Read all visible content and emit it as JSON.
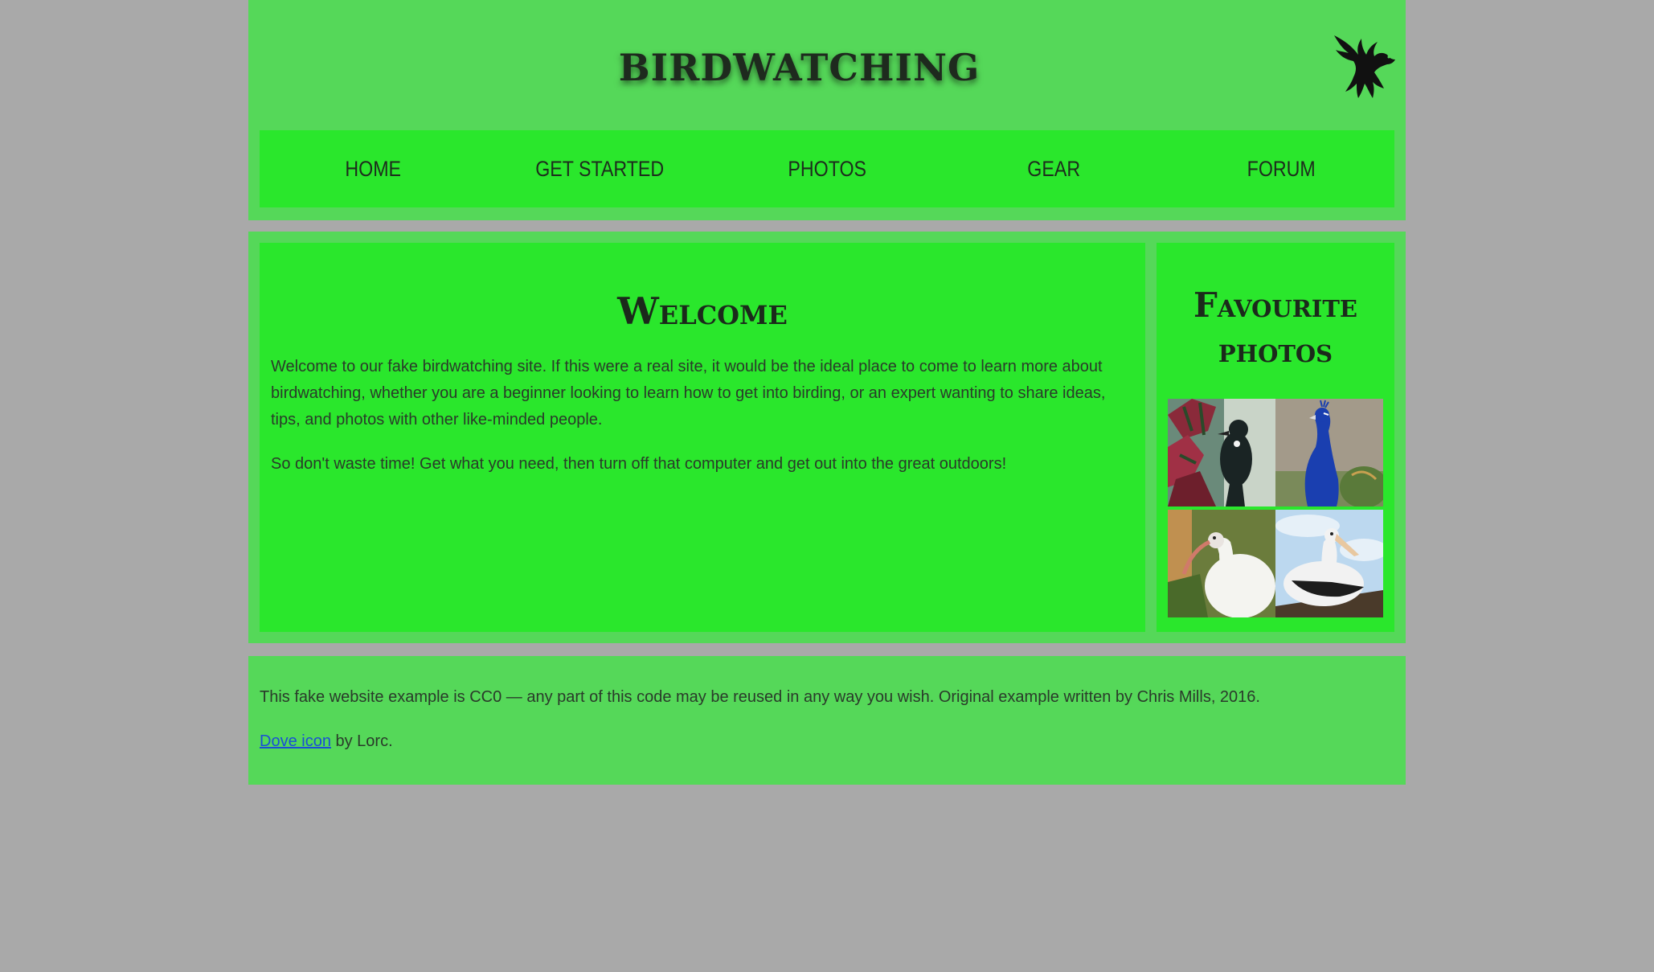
{
  "header": {
    "site_title": "Birdwatching",
    "logo_icon": "dove-icon"
  },
  "nav": {
    "items": [
      {
        "label": "HOME"
      },
      {
        "label": "GET STARTED"
      },
      {
        "label": "PHOTOS"
      },
      {
        "label": "GEAR"
      },
      {
        "label": "FORUM"
      }
    ]
  },
  "main": {
    "article": {
      "heading": "Welcome",
      "paragraph_1": "Welcome to our fake birdwatching site. If this were a real site, it would be the ideal place to come to learn more about birdwatching, whether you are a beginner looking to learn how to get into birding, or an expert wanting to share ideas, tips, and photos with other like-minded people.",
      "paragraph_2": "So don't waste time! Get what you need, then turn off that computer and get out into the great outdoors!"
    },
    "aside": {
      "heading": "Favourite photos",
      "photos": [
        "tui-photo",
        "peacock-photo",
        "ibis-photo",
        "pelican-photo"
      ]
    }
  },
  "footer": {
    "license_text": "This fake website example is CC0 — any part of this code may be reused in any way you wish. Original example written by Chris Mills, 2016.",
    "credit_link": "Dove icon",
    "credit_suffix": " by Lorc."
  },
  "colors": {
    "page_background": "#a9a9a9",
    "panel_green": "#55d859",
    "bright_green": "#2ae72c",
    "link_blue": "#1a4fd6"
  }
}
